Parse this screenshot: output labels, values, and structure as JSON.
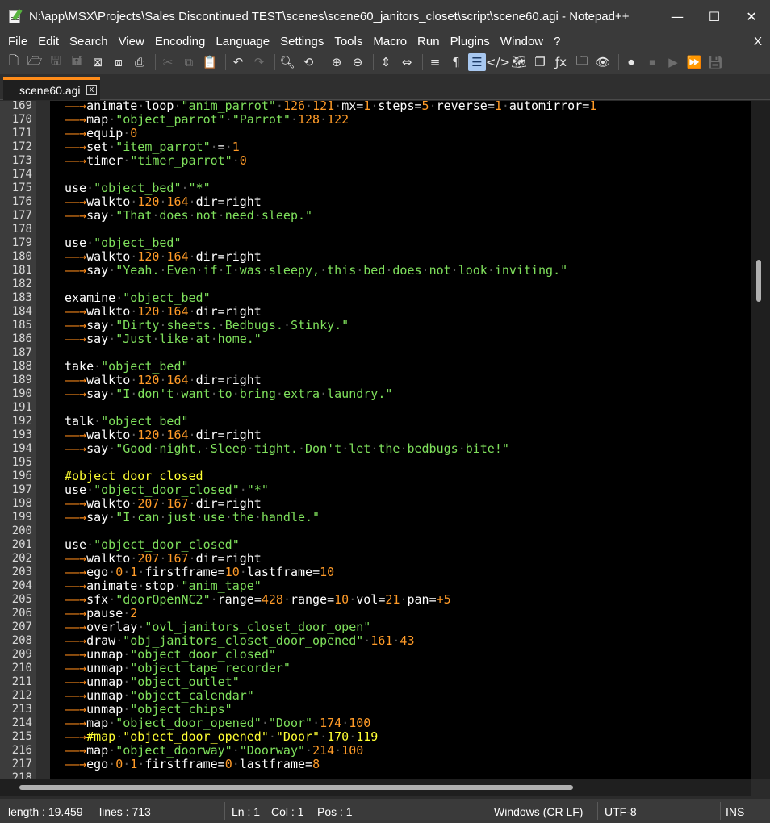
{
  "window": {
    "title": "N:\\app\\MSX\\Projects\\Sales Discontinued TEST\\scenes\\scene60_janitors_closet\\script\\scene60.agi - Notepad++",
    "minimize": "—",
    "maximize": "☐",
    "close": "✕"
  },
  "menu": {
    "items": [
      "File",
      "Edit",
      "Search",
      "View",
      "Encoding",
      "Language",
      "Settings",
      "Tools",
      "Macro",
      "Run",
      "Plugins",
      "Window",
      "?"
    ],
    "close": "X"
  },
  "toolbar": {
    "icons": [
      "new-file-icon",
      "open-file-icon",
      "save-icon",
      "save-all-icon",
      "close-icon",
      "close-all-icon",
      "print-icon",
      "cut-icon",
      "copy-icon",
      "paste-icon",
      "undo-icon",
      "redo-icon",
      "find-icon",
      "replace-icon",
      "zoom-in-icon",
      "zoom-out-icon",
      "sync-vertical-icon",
      "sync-horizontal-icon",
      "word-wrap-icon",
      "show-all-chars-icon",
      "indent-guide-icon",
      "user-defined-lang-icon",
      "doc-map-icon",
      "doc-list-icon",
      "function-list-icon",
      "folder-workspace-icon",
      "monitoring-icon",
      "record-macro-icon",
      "stop-macro-icon",
      "play-macro-icon",
      "run-macro-multiple-icon",
      "save-macro-icon"
    ]
  },
  "tab": {
    "label": "scene60.agi",
    "close": "x"
  },
  "editor": {
    "lines": [
      {
        "n": "169",
        "t": "→animate·loop·\"anim_parrot\"·126·121·mx=1·steps=5·reverse=1·automirror=1"
      },
      {
        "n": "170",
        "t": "→map·\"object_parrot\"·\"Parrot\"·128·122"
      },
      {
        "n": "171",
        "t": "→equip·0"
      },
      {
        "n": "172",
        "t": "→set·\"item_parrot\"·=·1"
      },
      {
        "n": "173",
        "t": "→timer·\"timer_parrot\"·0"
      },
      {
        "n": "174",
        "t": ""
      },
      {
        "n": "175",
        "t": "use·\"object_bed\"·\"*\""
      },
      {
        "n": "176",
        "t": "→walkto·120·164·dir=right"
      },
      {
        "n": "177",
        "t": "→say·\"That·does·not·need·sleep.\""
      },
      {
        "n": "178",
        "t": ""
      },
      {
        "n": "179",
        "t": "use·\"object_bed\""
      },
      {
        "n": "180",
        "t": "→walkto·120·164·dir=right"
      },
      {
        "n": "181",
        "t": "→say·\"Yeah.·Even·if·I·was·sleepy,·this·bed·does·not·look·inviting.\""
      },
      {
        "n": "182",
        "t": ""
      },
      {
        "n": "183",
        "t": "examine·\"object_bed\""
      },
      {
        "n": "184",
        "t": "→walkto·120·164·dir=right"
      },
      {
        "n": "185",
        "t": "→say·\"Dirty·sheets.·Bedbugs.·Stinky.\""
      },
      {
        "n": "186",
        "t": "→say·\"Just·like·at·home.\""
      },
      {
        "n": "187",
        "t": ""
      },
      {
        "n": "188",
        "t": "take·\"object_bed\""
      },
      {
        "n": "189",
        "t": "→walkto·120·164·dir=right"
      },
      {
        "n": "190",
        "t": "→say·\"I·don't·want·to·bring·extra·laundry.\""
      },
      {
        "n": "191",
        "t": ""
      },
      {
        "n": "192",
        "t": "talk·\"object_bed\""
      },
      {
        "n": "193",
        "t": "→walkto·120·164·dir=right"
      },
      {
        "n": "194",
        "t": "→say·\"Good·night.·Sleep·tight.·Don't·let·the·bedbugs·bite!\""
      },
      {
        "n": "195",
        "t": ""
      },
      {
        "n": "196",
        "t": "#object_door_closed"
      },
      {
        "n": "197",
        "t": "use·\"object_door_closed\"·\"*\""
      },
      {
        "n": "198",
        "t": "→walkto·207·167·dir=right"
      },
      {
        "n": "199",
        "t": "→say·\"I·can·just·use·the·handle.\""
      },
      {
        "n": "200",
        "t": ""
      },
      {
        "n": "201",
        "t": "use·\"object_door_closed\""
      },
      {
        "n": "202",
        "t": "→walkto·207·167·dir=right"
      },
      {
        "n": "203",
        "t": "→ego·0·1·firstframe=10·lastframe=10"
      },
      {
        "n": "204",
        "t": "→animate·stop·\"anim_tape\""
      },
      {
        "n": "205",
        "t": "→sfx·\"doorOpenNC2\"·range=428·range=10·vol=21·pan=+5"
      },
      {
        "n": "206",
        "t": "→pause·2"
      },
      {
        "n": "207",
        "t": "→overlay·\"ovl_janitors_closet_door_open\""
      },
      {
        "n": "208",
        "t": "→draw·\"obj_janitors_closet_door_opened\"·161·43"
      },
      {
        "n": "209",
        "t": "→unmap·\"object_door_closed\""
      },
      {
        "n": "210",
        "t": "→unmap·\"object_tape_recorder\""
      },
      {
        "n": "211",
        "t": "→unmap·\"object_outlet\""
      },
      {
        "n": "212",
        "t": "→unmap·\"object_calendar\""
      },
      {
        "n": "213",
        "t": "→unmap·\"object_chips\""
      },
      {
        "n": "214",
        "t": "→map·\"object_door_opened\"·\"Door\"·174·100"
      },
      {
        "n": "215",
        "t": "→#map·\"object_door_opened\"·\"Door\"·170·119"
      },
      {
        "n": "216",
        "t": "→map·\"object_doorway\"·\"Doorway\"·214·100"
      },
      {
        "n": "217",
        "t": "→ego·0·1·firstframe=0·lastframe=8"
      },
      {
        "n": "218",
        "t": ""
      }
    ]
  },
  "status": {
    "length": "length : 19.459",
    "lines": "lines : 713",
    "ln": "Ln : 1",
    "col": "Col : 1",
    "pos": "Pos : 1",
    "eol": "Windows (CR LF)",
    "encoding": "UTF-8",
    "mode": "INS"
  },
  "colors": {
    "string": "#7fe05c",
    "number": "#ff9b28",
    "tab_arrow": "#ff8c1a",
    "comment": "#ffff33",
    "active_tab_accent": "#ff8c1a"
  }
}
